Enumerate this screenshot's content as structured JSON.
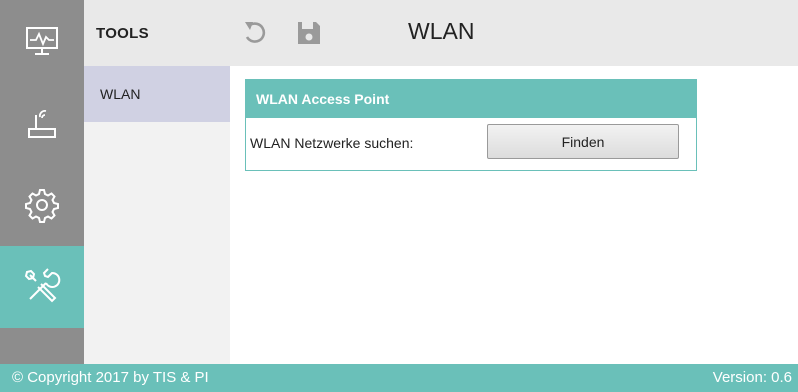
{
  "rail": {
    "items": [
      {
        "icon": "monitor-icon",
        "active": false
      },
      {
        "icon": "router-icon",
        "active": false
      },
      {
        "icon": "gear-icon",
        "active": false
      },
      {
        "icon": "tools-icon",
        "active": true
      }
    ]
  },
  "tools": {
    "header": "TOOLS",
    "items": [
      {
        "label": "WLAN",
        "selected": true
      }
    ]
  },
  "topbar": {
    "undo_icon": "undo-icon",
    "save_icon": "save-icon",
    "title": "WLAN"
  },
  "panel": {
    "title": "WLAN Access Point",
    "search_label": "WLAN Netzwerke suchen:",
    "find_button": "Finden"
  },
  "footer": {
    "copyright": "© Copyright 2017 by TIS & PI",
    "version": "Version: 0.6"
  },
  "colors": {
    "accent": "#6ac0b9",
    "rail": "#8d8d8d",
    "selected_item": "#d0d1e3",
    "topbar": "#e9e9e9"
  }
}
